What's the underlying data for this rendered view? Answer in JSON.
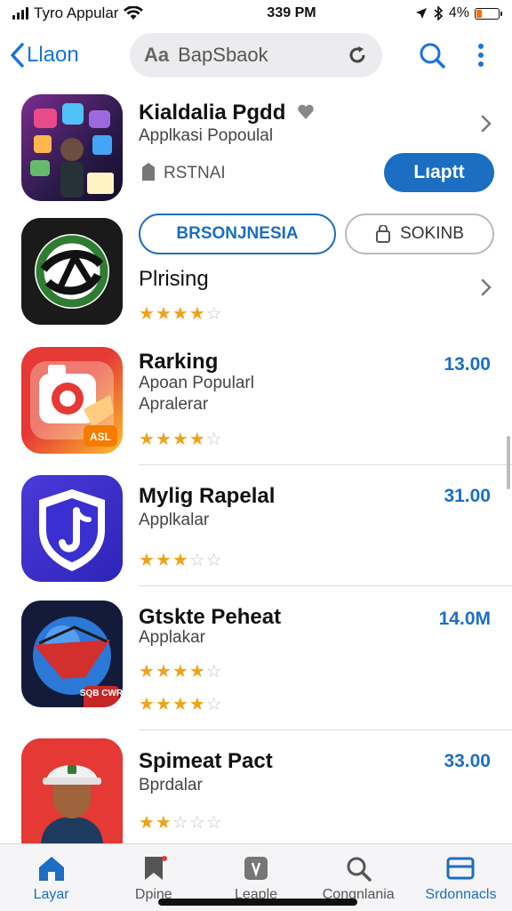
{
  "status_bar": {
    "carrier": "Tyro Appular",
    "time": "339 PM",
    "battery": "4%",
    "battery_level": 0.25,
    "battery_color": "#ff6b00"
  },
  "nav": {
    "back_label": "Llaon",
    "search_prefix": "Aa",
    "search_value": "BapSbaok",
    "accent_color": "#1b6ec2"
  },
  "apps": [
    {
      "title": "Kialdalia Pgdd",
      "subtitle": "Applkasi Popoulal",
      "tag": "RSTNAI",
      "action_label": "Lıaptt",
      "pill_primary": "BRSONJNESIA",
      "pill_secondary": "SOKINB"
    },
    {
      "title": "Plrising",
      "rating": 4
    },
    {
      "title": "Rarking",
      "subtitle": "Apoan Popularl",
      "subtitle2": "Apralerar",
      "price": "13.00",
      "icon_badge": "ASL",
      "rating": 4
    },
    {
      "title": "Mylig Rapelal",
      "subtitle": "Applkalar",
      "price": "31.00",
      "rating": 3
    },
    {
      "title": "Gtskte Peheat",
      "subtitle": "Applakar",
      "price": "14.0M",
      "icon_badge": "SQB CWR",
      "rating": 4,
      "rating_secondary": 3.5
    },
    {
      "title": "Spimeat Pact",
      "subtitle": "Bprdalar",
      "price": "33.00",
      "rating": 1.5
    }
  ],
  "tabs": [
    {
      "label": "Layar",
      "icon": "home-icon",
      "active": true
    },
    {
      "label": "Dpine",
      "icon": "bookmark-icon",
      "active": false
    },
    {
      "label": "Leaple",
      "icon": "app-icon",
      "active": false
    },
    {
      "label": "Congnlania",
      "icon": "search-icon",
      "active": false
    },
    {
      "label": "Srdonnacls",
      "icon": "card-icon",
      "active": true
    }
  ]
}
